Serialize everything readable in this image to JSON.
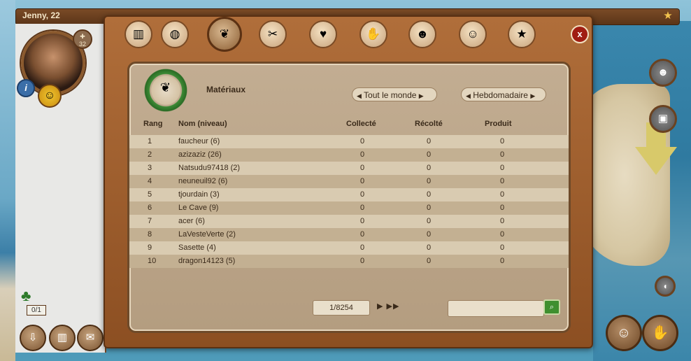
{
  "hud": {
    "player_name": "Jenny, 22",
    "level": "32",
    "info_label": "i",
    "palm_count": "0/1"
  },
  "tabs": [
    {
      "icon": "trophy-icon"
    },
    {
      "icon": "globe-icon"
    },
    {
      "icon": "leaf-icon",
      "active": true
    },
    {
      "icon": "tools-icon"
    },
    {
      "icon": "heart-bubble-icon"
    },
    {
      "icon": "handshake-icon"
    },
    {
      "icon": "group-icon"
    },
    {
      "icon": "person-icon"
    },
    {
      "icon": "star-icon"
    }
  ],
  "close_label": "x",
  "ranking": {
    "title": "Matériaux",
    "scope": "Tout le monde",
    "period": "Hebdomadaire",
    "columns": [
      "Rang",
      "Nom (niveau)",
      "Collecté",
      "Récolté",
      "Produit"
    ],
    "rows": [
      {
        "rank": "1",
        "name": "faucheur (6)",
        "collected": "0",
        "harvested": "0",
        "produced": "0"
      },
      {
        "rank": "2",
        "name": "azizaziz (26)",
        "collected": "0",
        "harvested": "0",
        "produced": "0"
      },
      {
        "rank": "3",
        "name": "Natsudu97418 (2)",
        "collected": "0",
        "harvested": "0",
        "produced": "0"
      },
      {
        "rank": "4",
        "name": "neuneuil92 (6)",
        "collected": "0",
        "harvested": "0",
        "produced": "0"
      },
      {
        "rank": "5",
        "name": "tjourdain (3)",
        "collected": "0",
        "harvested": "0",
        "produced": "0"
      },
      {
        "rank": "6",
        "name": "Le Cave (9)",
        "collected": "0",
        "harvested": "0",
        "produced": "0"
      },
      {
        "rank": "7",
        "name": "acer (6)",
        "collected": "0",
        "harvested": "0",
        "produced": "0"
      },
      {
        "rank": "8",
        "name": "LaVesteVerte (2)",
        "collected": "0",
        "harvested": "0",
        "produced": "0"
      },
      {
        "rank": "9",
        "name": "Sasette (4)",
        "collected": "0",
        "harvested": "0",
        "produced": "0"
      },
      {
        "rank": "10",
        "name": "dragon14123 (5)",
        "collected": "0",
        "harvested": "0",
        "produced": "0"
      }
    ],
    "page": "1/8254",
    "search_value": ""
  },
  "colors": {
    "frame_brown": "#8c4f22",
    "panel_beige": "#c2ad92",
    "row_light": "#d9cbb1",
    "row_dark": "#c3b092",
    "close_red": "#a01d12",
    "search_green": "#3f8f2f"
  }
}
